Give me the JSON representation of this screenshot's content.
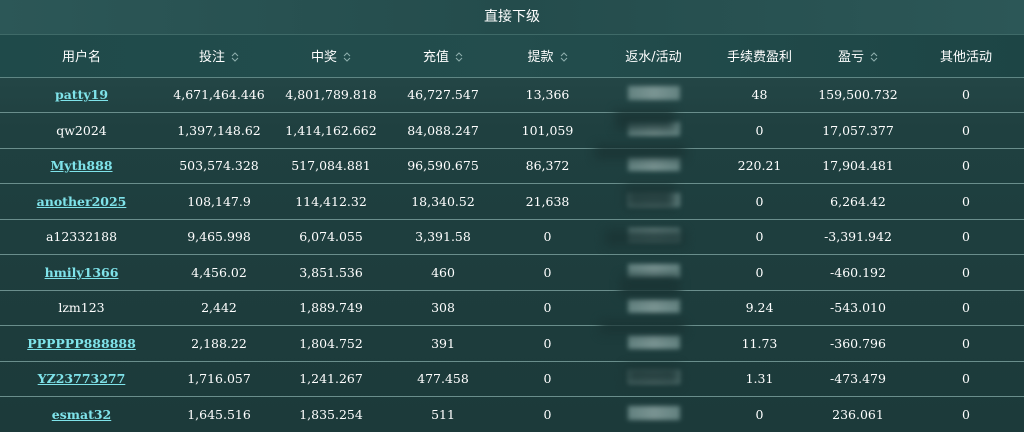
{
  "title": "直接下级",
  "columns": [
    {
      "label": "用户名",
      "sortable": false
    },
    {
      "label": "投注",
      "sortable": true
    },
    {
      "label": "中奖",
      "sortable": true
    },
    {
      "label": "充值",
      "sortable": true
    },
    {
      "label": "提款",
      "sortable": true
    },
    {
      "label": "返水/活动",
      "sortable": false
    },
    {
      "label": "手续费盈利",
      "sortable": false
    },
    {
      "label": "盈亏",
      "sortable": true
    },
    {
      "label": "其他活动",
      "sortable": false
    }
  ],
  "rows": [
    {
      "username": "patty19",
      "link": true,
      "bet": "4,671,464.446",
      "win": "4,801,789.818",
      "deposit": "46,727.547",
      "withdraw": "13,366",
      "rebate": "",
      "fee_profit": "48",
      "pnl": "159,500.732",
      "other": "0"
    },
    {
      "username": "qw2024",
      "link": false,
      "bet": "1,397,148.62",
      "win": "1,414,162.662",
      "deposit": "84,088.247",
      "withdraw": "101,059",
      "rebate": "",
      "fee_profit": "0",
      "pnl": "17,057.377",
      "other": "0"
    },
    {
      "username": "Myth888",
      "link": true,
      "bet": "503,574.328",
      "win": "517,084.881",
      "deposit": "96,590.675",
      "withdraw": "86,372",
      "rebate": "",
      "fee_profit": "220.21",
      "pnl": "17,904.481",
      "other": "0"
    },
    {
      "username": "another2025",
      "link": true,
      "bet": "108,147.9",
      "win": "114,412.32",
      "deposit": "18,340.52",
      "withdraw": "21,638",
      "rebate": "",
      "fee_profit": "0",
      "pnl": "6,264.42",
      "other": "0"
    },
    {
      "username": "a12332188",
      "link": false,
      "bet": "9,465.998",
      "win": "6,074.055",
      "deposit": "3,391.58",
      "withdraw": "0",
      "rebate": "",
      "fee_profit": "0",
      "pnl": "-3,391.942",
      "other": "0"
    },
    {
      "username": "hmily1366",
      "link": true,
      "bet": "4,456.02",
      "win": "3,851.536",
      "deposit": "460",
      "withdraw": "0",
      "rebate": "",
      "fee_profit": "0",
      "pnl": "-460.192",
      "other": "0"
    },
    {
      "username": "lzm123",
      "link": false,
      "bet": "2,442",
      "win": "1,889.749",
      "deposit": "308",
      "withdraw": "0",
      "rebate": "",
      "fee_profit": "9.24",
      "pnl": "-543.010",
      "other": "0"
    },
    {
      "username": "PPPPPP888888",
      "link": true,
      "bet": "2,188.22",
      "win": "1,804.752",
      "deposit": "391",
      "withdraw": "0",
      "rebate": "",
      "fee_profit": "11.73",
      "pnl": "-360.796",
      "other": "0"
    },
    {
      "username": "YZ23773277",
      "link": true,
      "bet": "1,716.057",
      "win": "1,241.267",
      "deposit": "477.458",
      "withdraw": "0",
      "rebate": "",
      "fee_profit": "1.31",
      "pnl": "-473.479",
      "other": "0"
    },
    {
      "username": "esmat32",
      "link": true,
      "bet": "1,645.516",
      "win": "1,835.254",
      "deposit": "511",
      "withdraw": "0",
      "rebate": "",
      "fee_profit": "0",
      "pnl": "236.061",
      "other": "0"
    }
  ],
  "colors": {
    "link": "#7fe3ea",
    "text": "#ffffff",
    "background": "#1f4040",
    "divider": "#6a8e8c"
  },
  "icons": {
    "sort": "sort-arrows-icon"
  }
}
